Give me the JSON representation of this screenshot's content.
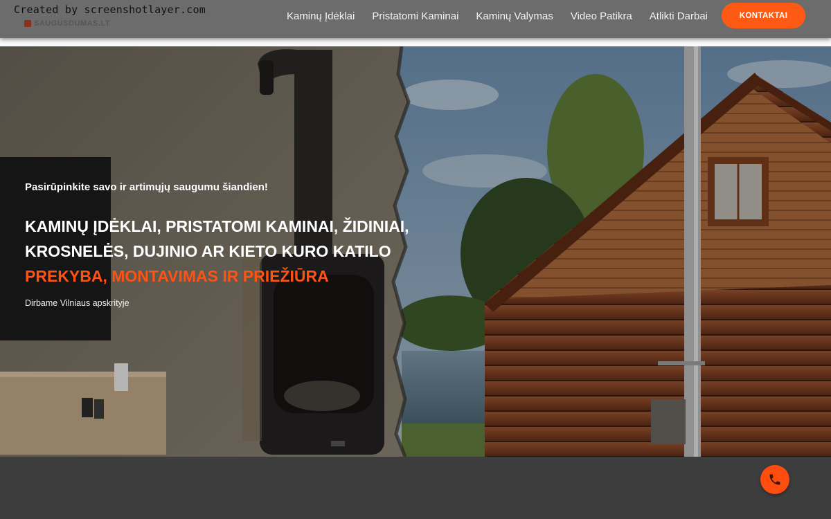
{
  "watermark": "Created by screenshotlayer.com",
  "logo": {
    "text": "SAUGUSDUMAS.LT"
  },
  "nav": {
    "items": [
      {
        "label": "Kaminų Įdėklai"
      },
      {
        "label": "Pristatomi Kaminai"
      },
      {
        "label": "Kaminų Valymas"
      },
      {
        "label": "Video Patikra"
      },
      {
        "label": "Atlikti Darbai"
      }
    ],
    "cta_label": "KONTAKTAI"
  },
  "hero": {
    "tagline": "Pasirūpinkite savo ir artimųjų saugumu šiandien!",
    "headline_line1": "KAMINŲ ĮDĖKLAI, PRISTATOMI KAMINAI, ŽIDINIAI,",
    "headline_line2": "KROSNELĖS, DUJINIO AR KIETO KURO KATILO",
    "headline_accent": "PREKYBA, MONTAVIMAS IR PRIEŽIŪRA",
    "region": "Dirbame Vilniaus apskrityje"
  },
  "colors": {
    "accent": "#ff5a14",
    "header_bg": "#6c6c6c",
    "footer_bg": "#3d3d3d"
  },
  "icons": {
    "call_fab": "phone-icon"
  }
}
